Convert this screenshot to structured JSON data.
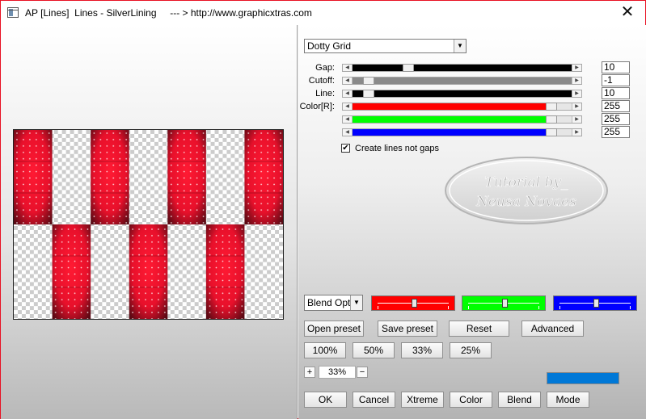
{
  "window": {
    "title": "AP [Lines]  Lines - SilverLining     --- > http://www.graphicxtras.com",
    "close_glyph": "✕"
  },
  "filter": {
    "selected": "Dotty Grid"
  },
  "sliders": [
    {
      "id": "gap",
      "label": "Gap:",
      "value": "10",
      "fill_color": "#000000",
      "position": 0.24
    },
    {
      "id": "cutoff",
      "label": "Cutoff:",
      "value": "-1",
      "fill_color": "#8a8a8a",
      "position": 0.05
    },
    {
      "id": "line",
      "label": "Line:",
      "value": "10",
      "fill_color": "#000000",
      "position": 0.05
    },
    {
      "id": "red",
      "label": "Color[R]:",
      "value": "255",
      "fill_color": "#ff0000",
      "position": 0.93
    },
    {
      "id": "green",
      "label": "",
      "value": "255",
      "fill_color": "#00ff00",
      "position": 0.93
    },
    {
      "id": "blue",
      "label": "",
      "value": "255",
      "fill_color": "#0000ff",
      "position": 0.93
    }
  ],
  "checkbox": {
    "label": "Create lines not gaps",
    "checked": true,
    "mark": "✔"
  },
  "watermark": {
    "line1": "Tutorial by_",
    "line2": "Neusa Novaes"
  },
  "blend": {
    "selected": "Blend Optio",
    "swatches": [
      {
        "color": "#ff0000",
        "level": 0.5
      },
      {
        "color": "#00ff00",
        "level": 0.5
      },
      {
        "color": "#0000ff",
        "level": 0.5
      }
    ]
  },
  "buttons": {
    "open_preset": "Open preset",
    "save_preset": "Save preset",
    "reset": "Reset",
    "advanced": "Advanced",
    "zoom_100": "100%",
    "zoom_50": "50%",
    "zoom_33": "33%",
    "zoom_25": "25%",
    "ok": "OK",
    "cancel": "Cancel",
    "xtreme": "Xtreme",
    "color": "Color",
    "blend": "Blend",
    "mode": "Mode"
  },
  "zoom": {
    "plus": "+",
    "minus": "−",
    "value": "33%"
  },
  "colors": {
    "accent_blue": "#0078d7",
    "pattern_red": "#e8102b",
    "pattern_dark": "#5a0a14"
  }
}
